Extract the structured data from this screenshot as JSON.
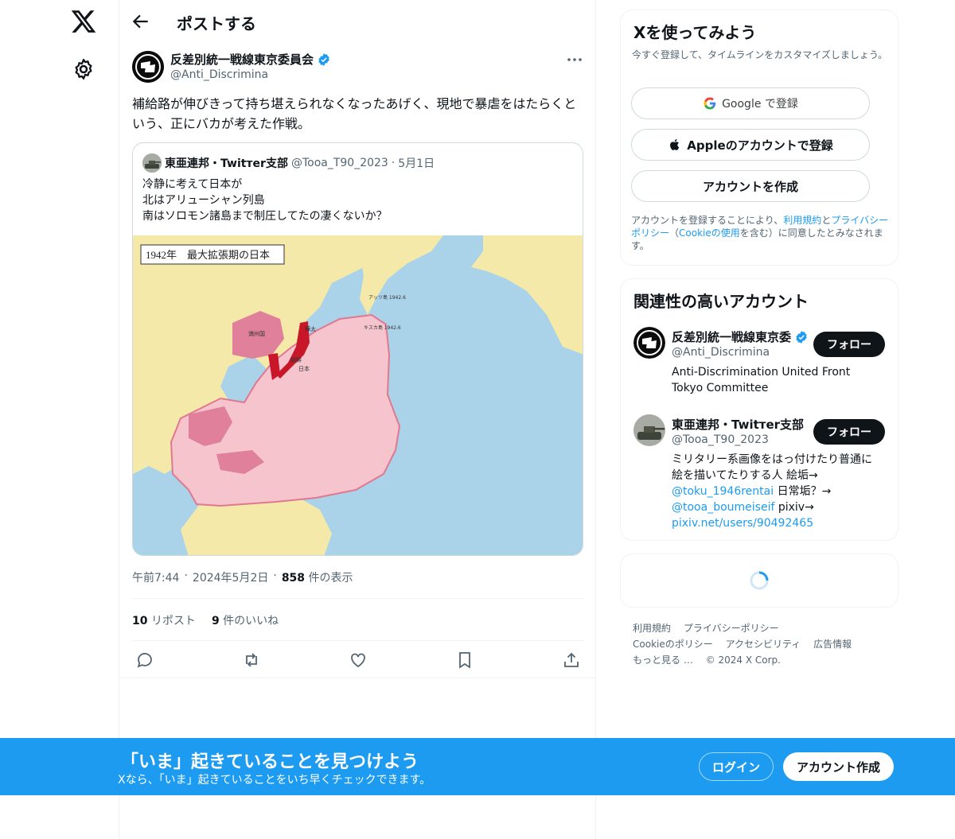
{
  "header": {
    "title": "ポストする"
  },
  "author": {
    "name": "反差別統一戦線東京委員会",
    "handle": "@Anti_Discrimina"
  },
  "tweet": {
    "text": "補給路が伸びきって持ち堪えられなくなったあげく、現地で暴虐をはたらくという、正にバカが考えた作戦。"
  },
  "quote": {
    "name": "東亜連邦・Twitтеr支部",
    "handle": "@Tooa_T90_2023",
    "dot": "·",
    "date": "5月1日",
    "lines": [
      "冷静に考えて日本が",
      "北はアリューシャン列島",
      "南はソロモン諸島まで制圧してたの凄くないか？"
    ],
    "map_label": "1942年　最大拡張期の日本",
    "map_places": {
      "manchukuo": "満州国",
      "korea": "朝鮮",
      "japan": "日本",
      "sakhalin": "樺太",
      "attu": "アッツ島 1942.6",
      "kiska": "キスカ島 1942.6"
    }
  },
  "meta": {
    "time": "午前7:44",
    "sep": "·",
    "date": "2024年5月2日",
    "views_count": "858",
    "views_label": "件の表示"
  },
  "stats": {
    "reposts_count": "10",
    "reposts_label": "リポスト",
    "likes_count": "9",
    "likes_label": "件のいいね"
  },
  "signup": {
    "title": "Xを使ってみよう",
    "subtitle": "今すぐ登録して、タイムラインをカスタマイズしましょう。",
    "google_label": "Google で登録",
    "apple_label": "Appleのアカウントで登録",
    "create_label": "アカウントを作成",
    "legal_1": "アカウントを登録することにより、",
    "legal_terms": "利用規約",
    "legal_2": "と",
    "legal_privacy": "プライバシーポリシー",
    "legal_3": "（",
    "legal_cookie": "Cookieの使用",
    "legal_4": "を含む）に同意したとみなされます。"
  },
  "related": {
    "title": "関連性の高いアカウント",
    "follow_label": "フォロー",
    "accounts": [
      {
        "name": "反差別統一戦線東京委",
        "handle": "@Anti_Discrimina",
        "bio": "Anti-Discrimination United Front Tokyo Committee"
      },
      {
        "name": "東亜連邦・Twitтеr支部",
        "handle": "@Tooa_T90_2023",
        "bio_1": "ミリタリー系画像をはっ付けたり普通に絵を描いてたりする人 絵垢→",
        "bio_link1": "@toku_1946rentai",
        "bio_2": " 日常垢？→",
        "bio_link2": "@tooa_boumeiseif",
        "bio_3": " pixiv→",
        "bio_link3": "pixiv.net/users/90492465"
      }
    ]
  },
  "footer": {
    "items": [
      "利用規約",
      "プライバシーポリシー",
      "Cookieのポリシー",
      "アクセシビリティ",
      "広告情報",
      "もっと見る …",
      "© 2024 X Corp."
    ]
  },
  "banner": {
    "title": "「いま」起きていることを見つけよう",
    "subtitle": "Xなら、「いま」起きていることをいち早くチェックできます。",
    "login_label": "ログイン",
    "create_label": "アカウント作成"
  },
  "colors": {
    "accent": "#1d9bf0",
    "text": "#0f1419",
    "secondary": "#536471",
    "border": "#eff3f4"
  }
}
